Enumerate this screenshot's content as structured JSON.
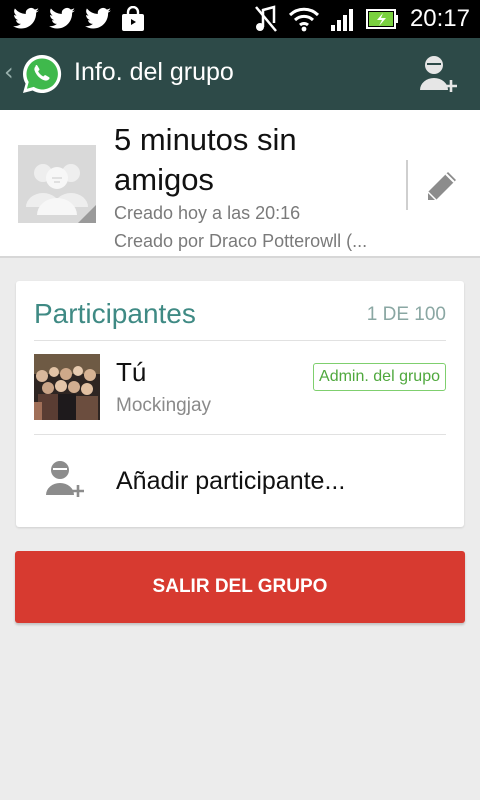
{
  "status_bar": {
    "time": "20:17",
    "icons": [
      "twitter-icon",
      "twitter-icon",
      "twitter-icon",
      "shopping-bag-icon",
      "mute-icon",
      "wifi-icon",
      "signal-icon",
      "battery-charging-icon"
    ]
  },
  "action_bar": {
    "back_glyph": "‹",
    "title": "Info. del grupo",
    "logo_icon": "whatsapp-logo",
    "action_icon": "add-contact-icon"
  },
  "group": {
    "name": "5 minutos sin amigos",
    "created": "Creado hoy a las 20:16",
    "created_by": "Creado por Draco Potterowll (...",
    "edit_icon": "pencil-icon"
  },
  "participants": {
    "title": "Participantes",
    "count": "1 DE 100",
    "items": [
      {
        "name": "Tú",
        "status": "Mockingjay",
        "badge": "Admin. del grupo"
      }
    ],
    "add_label": "Añadir participante..."
  },
  "leave_button": {
    "label": "SALIR DEL GRUPO"
  },
  "colors": {
    "action_bar": "#2d4a48",
    "accent": "#3f8a84",
    "admin_badge": "#4fa83d",
    "leave": "#d73a30"
  }
}
